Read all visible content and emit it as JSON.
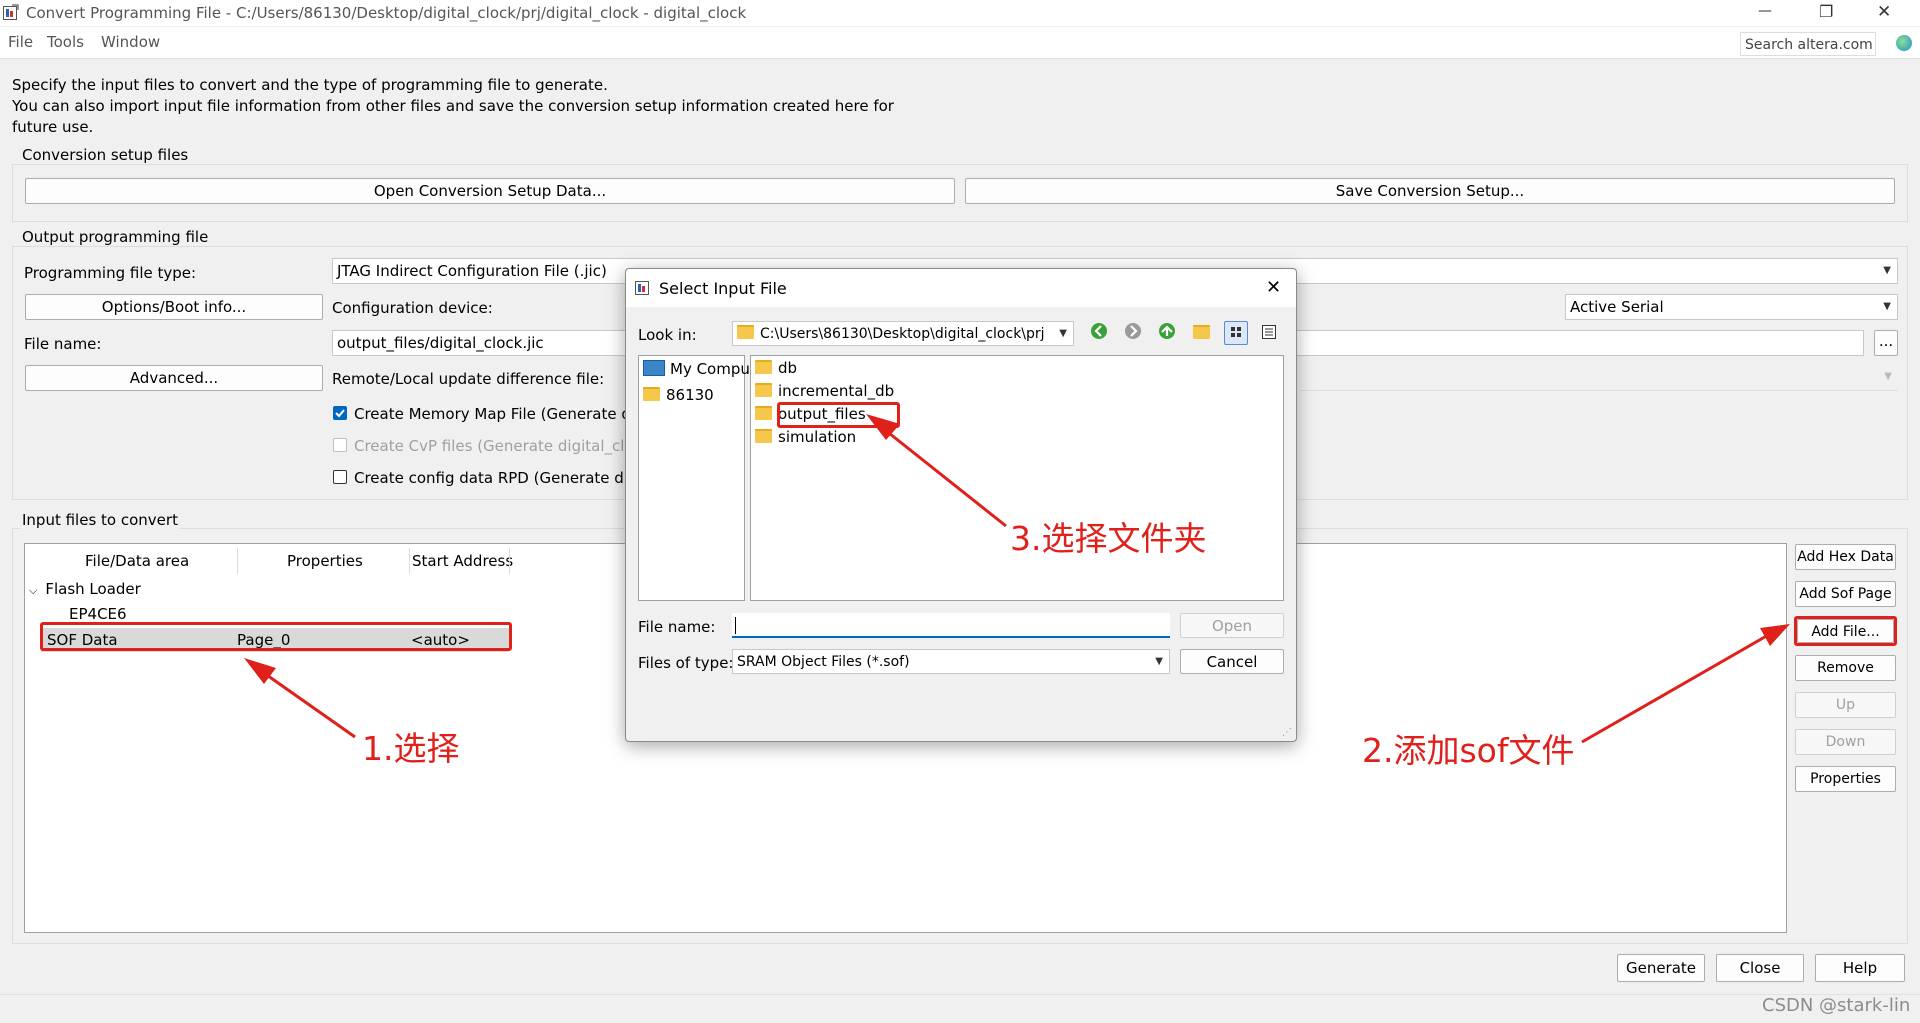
{
  "window": {
    "title": "Convert Programming File - C:/Users/86130/Desktop/digital_clock/prj/digital_clock - digital_clock",
    "minimize": "—",
    "restore": "❐",
    "close": "✕"
  },
  "menu": {
    "file": "File",
    "tools": "Tools",
    "window": "Window"
  },
  "search": {
    "placeholder": "Search altera.com"
  },
  "intro": {
    "line1": "Specify the input files to convert and the type of programming file to generate.",
    "line2": "You can also import input file information from other files and save the conversion setup information created here for",
    "line3": "future use."
  },
  "setup": {
    "title": "Conversion setup files",
    "open_label": "Open Conversion Setup Data...",
    "save_label": "Save Conversion Setup..."
  },
  "output": {
    "title": "Output programming file",
    "type_label": "Programming file type:",
    "type_value": "JTAG Indirect Configuration File (.jic)",
    "options_label": "Options/Boot info...",
    "config_label": "Configuration device:",
    "mode_value": "Active Serial",
    "filename_label": "File name:",
    "filename_value": "output_files/digital_clock.jic",
    "browse_label": "...",
    "advanced_label": "Advanced...",
    "remote_label": "Remote/Local update difference file:",
    "check_memmap": "Create Memory Map File (Generate digit",
    "check_cvp": "Create CvP files (Generate digital_clock.p",
    "check_rpd": "Create config data RPD (Generate digital"
  },
  "input": {
    "title": "Input files to convert",
    "col_file": "File/Data area",
    "col_props": "Properties",
    "col_addr": "Start Address",
    "flash_loader": "Flash Loader",
    "device": "EP4CE6",
    "sof_name": "SOF Data",
    "sof_page": "Page_0",
    "sof_addr": "<auto>"
  },
  "side_buttons": {
    "add_hex": "Add Hex Data",
    "add_sof": "Add Sof Page",
    "add_file": "Add File...",
    "remove": "Remove",
    "up": "Up",
    "down": "Down",
    "properties": "Properties"
  },
  "bottom": {
    "generate": "Generate",
    "close": "Close",
    "help": "Help"
  },
  "dialog": {
    "title": "Select Input File",
    "close": "✕",
    "lookin_label": "Look in:",
    "lookin_value": "C:\\Users\\86130\\Desktop\\digital_clock\\prj",
    "places": [
      "My Computer",
      "86130"
    ],
    "folders": [
      "db",
      "incremental_db",
      "output_files",
      "simulation"
    ],
    "filename_label": "File name:",
    "filename_value": "",
    "filetype_label": "Files of type:",
    "filetype_value": "SRAM Object Files (*.sof)",
    "open_label": "Open",
    "cancel_label": "Cancel"
  },
  "annotations": {
    "step1": "1.选择",
    "step2": "2.添加sof文件",
    "step3": "3.选择文件夹"
  },
  "watermark": "CSDN @stark-lin",
  "colors": {
    "accent": "#0067c0",
    "annotation": "#e0201b",
    "folder": "#f5c84b"
  }
}
